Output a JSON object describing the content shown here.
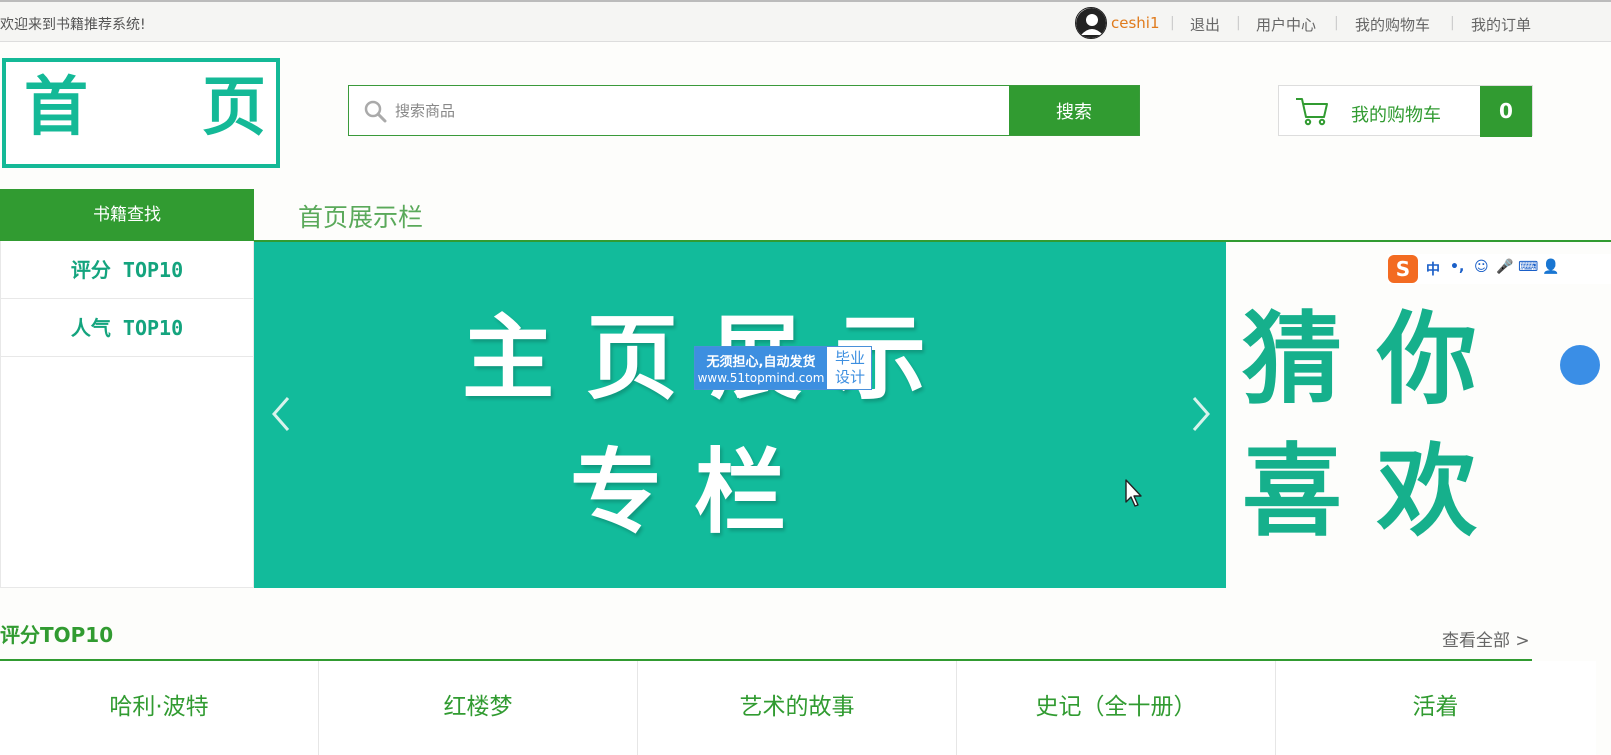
{
  "topbar": {
    "welcome": "欢迎来到书籍推荐系统!",
    "username": "ceshi1",
    "logout": "退出",
    "user_center": "用户中心",
    "my_cart": "我的购物车",
    "my_orders": "我的订单",
    "separator": "|"
  },
  "logo": {
    "char1": "首",
    "char2": "页"
  },
  "search": {
    "placeholder": "搜索商品",
    "value": "",
    "button": "搜索"
  },
  "cart": {
    "label": "我的购物车",
    "count": "0"
  },
  "category": {
    "title": "书籍查找",
    "items": [
      "评分 TOP10",
      "人气 TOP10"
    ]
  },
  "showcase": {
    "title": "首页展示栏",
    "banner_line1": "主 页 展 示",
    "banner_line2": "专 栏",
    "prev_icon": "chevron-left-icon",
    "next_icon": "chevron-right-icon"
  },
  "ad": {
    "line1": "无须担心,自动发货",
    "line2": "www.51topmind.com",
    "right1": "毕业",
    "right2": "设计"
  },
  "guess": {
    "line1": "猜 你",
    "line2": "喜 欢"
  },
  "ime": {
    "logo": "S",
    "items": [
      "中",
      "•,",
      "☺",
      "🎤",
      "⌨",
      "👤"
    ]
  },
  "rating_section": {
    "title": "评分TOP10",
    "see_all": "查看全部 >",
    "books": [
      "哈利·波特",
      "红楼梦",
      "艺术的故事",
      "史记（全十册）",
      "活着"
    ]
  },
  "colors": {
    "brand_green": "#319b31",
    "teal": "#12bb9b",
    "username_orange": "#e07b1c"
  }
}
